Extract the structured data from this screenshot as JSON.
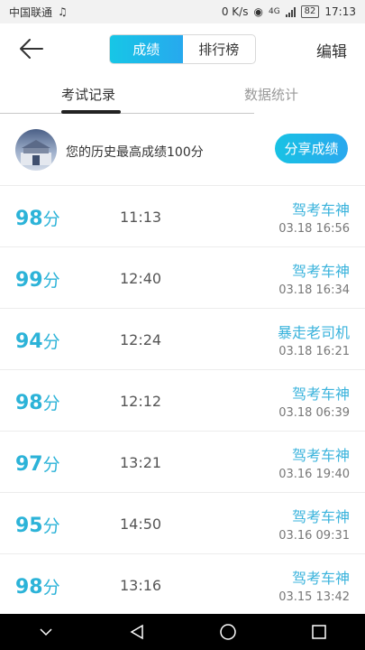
{
  "status_bar": {
    "carrier": "中国联通",
    "speed": "0 K/s",
    "network": "4G",
    "battery": "82",
    "time": "17:13"
  },
  "header": {
    "segments": [
      "成绩",
      "排行榜"
    ],
    "active_segment": 0,
    "edit_label": "编辑"
  },
  "tabs": [
    {
      "label": "考试记录",
      "active": true
    },
    {
      "label": "数据统计",
      "active": false
    }
  ],
  "summary": {
    "text": "您的历史最高成绩100分",
    "share_label": "分享成绩"
  },
  "records": [
    {
      "score": "98",
      "unit": "分",
      "duration": "11:13",
      "title": "驾考车神",
      "date": "03.18  16:56"
    },
    {
      "score": "99",
      "unit": "分",
      "duration": "12:40",
      "title": "驾考车神",
      "date": "03.18  16:34"
    },
    {
      "score": "94",
      "unit": "分",
      "duration": "12:24",
      "title": "暴走老司机",
      "date": "03.18  16:21"
    },
    {
      "score": "98",
      "unit": "分",
      "duration": "12:12",
      "title": "驾考车神",
      "date": "03.18  06:39"
    },
    {
      "score": "97",
      "unit": "分",
      "duration": "13:21",
      "title": "驾考车神",
      "date": "03.16  19:40"
    },
    {
      "score": "95",
      "unit": "分",
      "duration": "14:50",
      "title": "驾考车神",
      "date": "03.16  09:31"
    },
    {
      "score": "98",
      "unit": "分",
      "duration": "13:16",
      "title": "驾考车神",
      "date": "03.15  13:42"
    }
  ],
  "colors": {
    "accent": "#2cb3d8",
    "gradient_start": "#17c6e6",
    "gradient_end": "#27a9ee"
  }
}
